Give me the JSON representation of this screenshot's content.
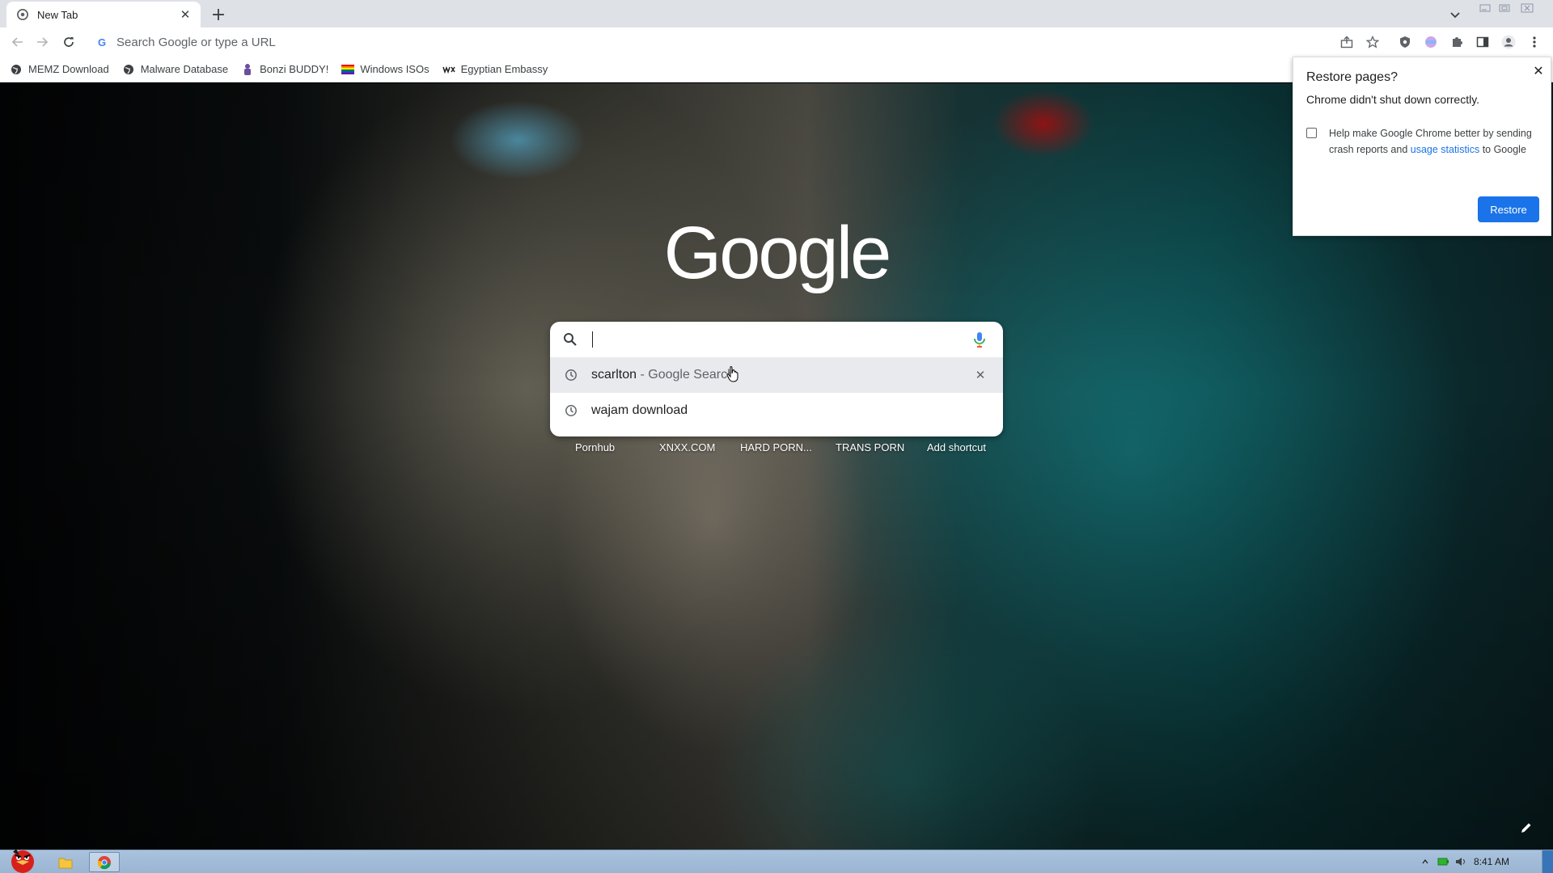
{
  "browser": {
    "tab": {
      "title": "New Tab"
    },
    "omnibox": {
      "placeholder": "Search Google or type a URL"
    },
    "bookmarks": [
      {
        "label": "MEMZ Download",
        "icon": "globe-icon"
      },
      {
        "label": "Malware Database",
        "icon": "globe-icon"
      },
      {
        "label": "Bonzi BUDDY!",
        "icon": "bonzi-icon"
      },
      {
        "label": "Windows ISOs",
        "icon": "rainbow-flag-icon"
      },
      {
        "label": "Egyptian Embassy",
        "icon": "wix-icon"
      }
    ]
  },
  "ntp": {
    "logo": "Google",
    "search": {
      "suggestions": [
        {
          "text": "scarlton",
          "suffix": " - Google Search"
        },
        {
          "text": "wajam download",
          "suffix": ""
        }
      ]
    },
    "shortcuts": [
      "Pornhub",
      "XNXX.COM",
      "HARD PORN...",
      "TRANS PORN",
      "Add shortcut"
    ]
  },
  "restore_bubble": {
    "title": "Restore pages?",
    "message": "Chrome didn't shut down correctly.",
    "checkbox_text_1": "Help make Google Chrome better by sending crash reports and ",
    "checkbox_link": "usage statistics",
    "checkbox_text_2": " to Google",
    "button": "Restore"
  },
  "taskbar": {
    "time": "8:41 AM"
  },
  "colors": {
    "accent": "#1a73e8",
    "tabstrip": "#dee1e6",
    "taskbar": "#a9c2dd"
  }
}
